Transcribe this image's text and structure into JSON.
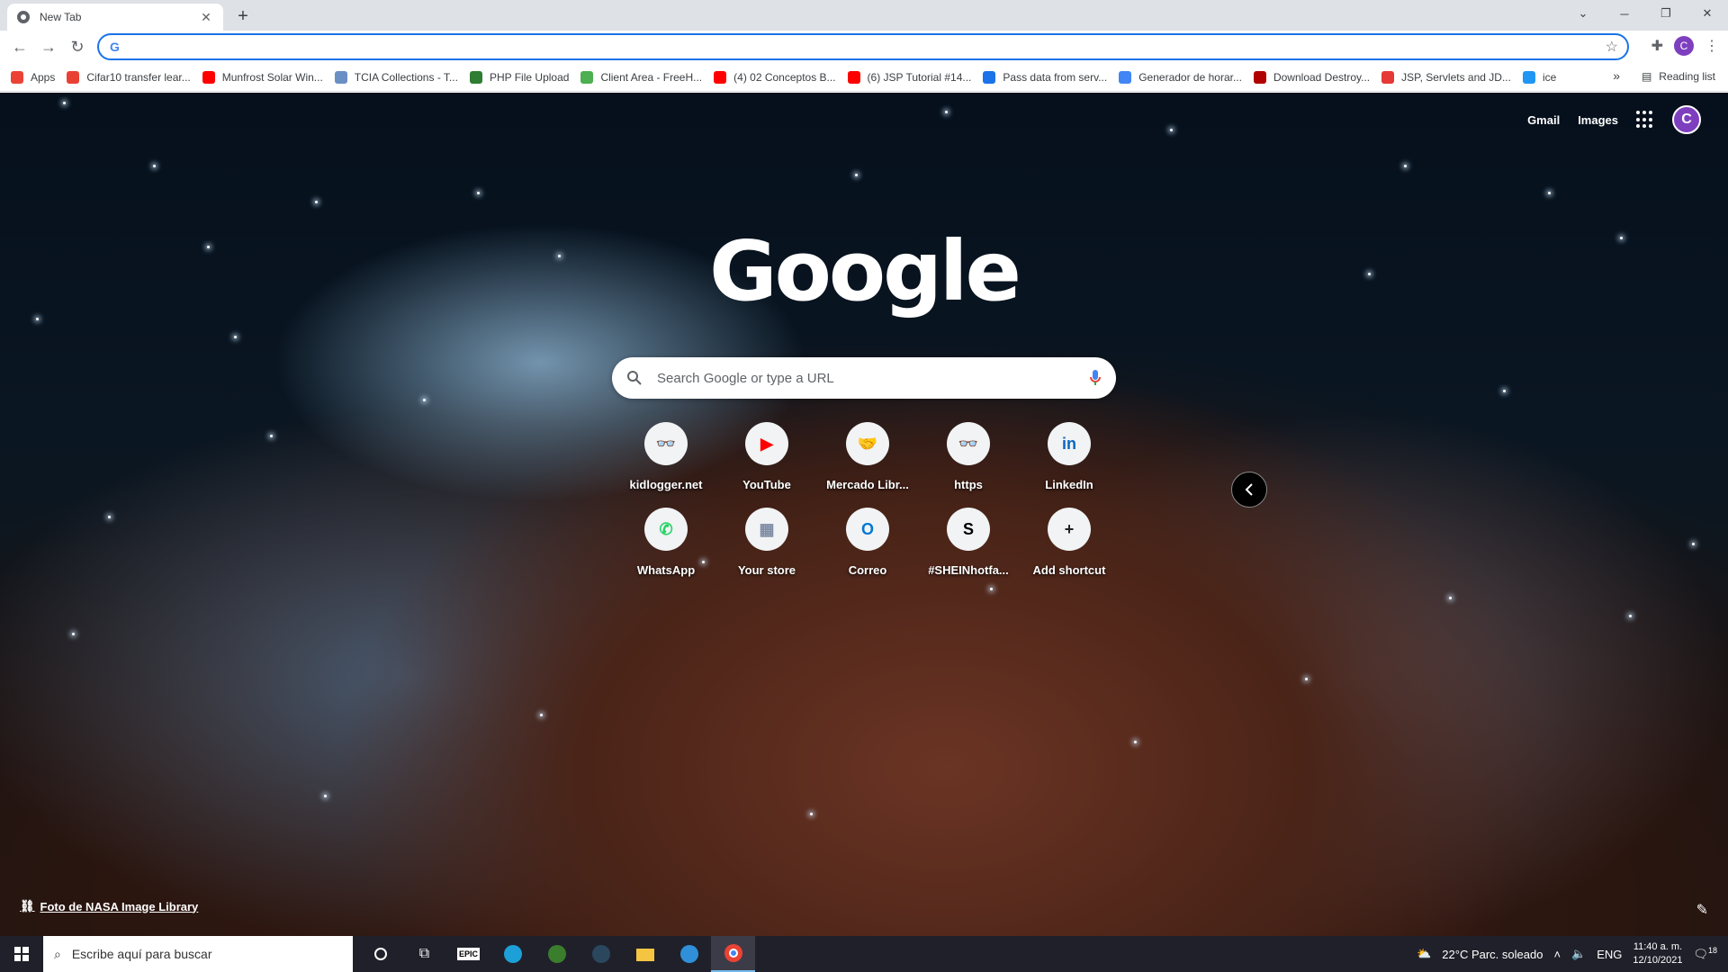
{
  "tab": {
    "title": "New Tab",
    "close": "✕"
  },
  "newtab_plus": "+",
  "window": {
    "min": "─",
    "restore": "❐",
    "close": "✕",
    "dropdown": "⌄"
  },
  "omnibox": {
    "value": "",
    "placeholder": ""
  },
  "bookmarks": [
    {
      "label": "Apps",
      "color": "#ea4335"
    },
    {
      "label": "Cifar10 transfer lear...",
      "color": "#e94235"
    },
    {
      "label": "Munfrost Solar Win...",
      "color": "#ff0000"
    },
    {
      "label": "TCIA Collections - T...",
      "color": "#6a8fc4"
    },
    {
      "label": "PHP File Upload",
      "color": "#2e7d32"
    },
    {
      "label": "Client Area - FreeH...",
      "color": "#4caf50"
    },
    {
      "label": "(4) 02 Conceptos B...",
      "color": "#ff0000"
    },
    {
      "label": "(6) JSP Tutorial #14...",
      "color": "#ff0000"
    },
    {
      "label": "Pass data from serv...",
      "color": "#1a73e8"
    },
    {
      "label": "Generador de horar...",
      "color": "#4285f4"
    },
    {
      "label": "Download Destroy...",
      "color": "#b00000"
    },
    {
      "label": "JSP, Servlets and JD...",
      "color": "#e53935"
    },
    {
      "label": "ice",
      "color": "#2196f3"
    }
  ],
  "bookmarks_more": "»",
  "reading_list": "Reading list",
  "top_links": {
    "gmail": "Gmail",
    "images": "Images",
    "avatar": "C"
  },
  "logo": "Google",
  "search": {
    "placeholder": "Search Google or type a URL"
  },
  "shortcuts": [
    {
      "label": "kidlogger.net",
      "glyph": "👓",
      "color": "#1a73e8"
    },
    {
      "label": "YouTube",
      "glyph": "▶",
      "color": "#ff0000"
    },
    {
      "label": "Mercado Libr...",
      "glyph": "🤝",
      "color": "#f5c400"
    },
    {
      "label": "https",
      "glyph": "👓",
      "color": "#1a73e8"
    },
    {
      "label": "LinkedIn",
      "glyph": "in",
      "color": "#0a66c2"
    },
    {
      "label": "WhatsApp",
      "glyph": "✆",
      "color": "#25d366"
    },
    {
      "label": "Your store",
      "glyph": "▦",
      "color": "#7d8aa3"
    },
    {
      "label": "Correo",
      "glyph": "O",
      "color": "#0078d4"
    },
    {
      "label": "#SHEINhotfa...",
      "glyph": "S",
      "color": "#000000"
    },
    {
      "label": "Add shortcut",
      "glyph": "+",
      "color": "#202124"
    }
  ],
  "credit": "Foto de NASA Image Library",
  "taskbar": {
    "search_placeholder": "Escribe aquí para buscar",
    "weather": "22°C  Parc. soleado",
    "lang": "ENG",
    "time": "11:40 a. m.",
    "date": "12/10/2021",
    "notif": "18"
  }
}
